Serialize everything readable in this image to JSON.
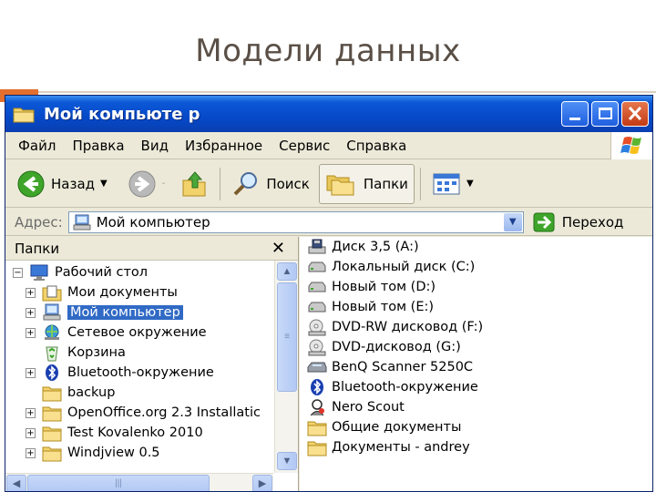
{
  "slide": {
    "title": "Модели данных"
  },
  "window": {
    "title": "Мой компьюте р",
    "menu": [
      "Файл",
      "Правка",
      "Вид",
      "Избранное",
      "Сервис",
      "Справка"
    ],
    "toolbar": {
      "back": "Назад",
      "search": "Поиск",
      "folders": "Папки"
    },
    "address": {
      "label": "Адрес:",
      "value": "Мой компьютер",
      "go": "Переход"
    },
    "folders_pane": {
      "title": "Папки",
      "tree": [
        {
          "label": "Рабочий стол",
          "icon": "desktop-icon",
          "indent": 0,
          "expander": "minus",
          "selected": false
        },
        {
          "label": "Мои документы",
          "icon": "my-documents-icon",
          "indent": 1,
          "expander": "plus",
          "selected": false
        },
        {
          "label": "Мой компьютер",
          "icon": "my-computer-icon",
          "indent": 1,
          "expander": "plus",
          "selected": true
        },
        {
          "label": "Сетевое окружение",
          "icon": "network-icon",
          "indent": 1,
          "expander": "plus",
          "selected": false
        },
        {
          "label": "Корзина",
          "icon": "recycle-bin-icon",
          "indent": 1,
          "expander": "none",
          "selected": false
        },
        {
          "label": "Bluetooth-окружение",
          "icon": "bluetooth-icon",
          "indent": 1,
          "expander": "plus",
          "selected": false
        },
        {
          "label": "backup",
          "icon": "folder-icon",
          "indent": 1,
          "expander": "none",
          "selected": false
        },
        {
          "label": "OpenOffice.org 2.3 Installatic",
          "icon": "folder-icon",
          "indent": 1,
          "expander": "plus",
          "selected": false
        },
        {
          "label": "Test Kovalenko 2010",
          "icon": "folder-icon",
          "indent": 1,
          "expander": "plus",
          "selected": false
        },
        {
          "label": "Windjview 0.5",
          "icon": "folder-icon",
          "indent": 1,
          "expander": "plus",
          "selected": false
        }
      ]
    },
    "content_items": [
      {
        "label": "Диск 3,5 (A:)",
        "icon": "floppy-drive-icon"
      },
      {
        "label": "Локальный диск (C:)",
        "icon": "hard-disk-icon"
      },
      {
        "label": "Новый том (D:)",
        "icon": "hard-disk-icon"
      },
      {
        "label": "Новый том (E:)",
        "icon": "hard-disk-icon"
      },
      {
        "label": "DVD-RW дисковод (F:)",
        "icon": "dvd-drive-icon"
      },
      {
        "label": "DVD-дисковод (G:)",
        "icon": "dvd-drive-icon"
      },
      {
        "label": "BenQ Scanner 5250C",
        "icon": "scanner-icon"
      },
      {
        "label": "Bluetooth-окружение",
        "icon": "bluetooth-icon"
      },
      {
        "label": "Nero Scout",
        "icon": "nero-scout-icon"
      },
      {
        "label": "Общие документы",
        "icon": "folder-icon"
      },
      {
        "label": "Документы - andrey",
        "icon": "folder-icon"
      }
    ]
  },
  "colors": {
    "accent_orange": "#e36f2f",
    "titlebar_blue": "#0549c9",
    "selection": "#316ac5"
  }
}
